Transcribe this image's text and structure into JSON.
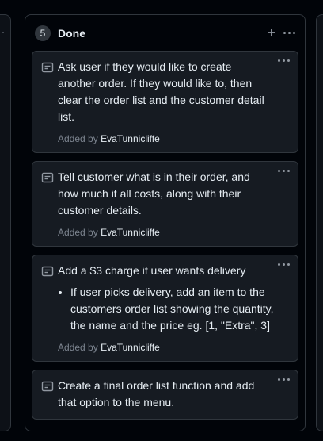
{
  "column": {
    "count": "5",
    "title": "Done"
  },
  "cards": [
    {
      "title": "Ask user if they would like to create another order. If they would like to, then clear the order list and the customer detail list.",
      "added_prefix": "Added by",
      "author": "EvaTunnicliffe"
    },
    {
      "title": "Tell customer what is in their order, and how much it all costs, along with their customer details.",
      "added_prefix": "Added by",
      "author": "EvaTunnicliffe"
    },
    {
      "title": "Add a $3 charge if user wants delivery",
      "bullets": [
        "If user picks delivery, add an item to the customers order list showing the quantity, the name and the price eg. [1, \"Extra\", 3]"
      ],
      "added_prefix": "Added by",
      "author": "EvaTunnicliffe"
    },
    {
      "title": "Create a final order list function and add that option to the menu."
    }
  ],
  "icons": {
    "card": "note-icon",
    "add": "plus-icon",
    "more": "kebab-horizontal-icon"
  },
  "colors": {
    "background": "#010409",
    "card": "#161b22",
    "border": "#30363d",
    "muted": "#7d8590"
  }
}
